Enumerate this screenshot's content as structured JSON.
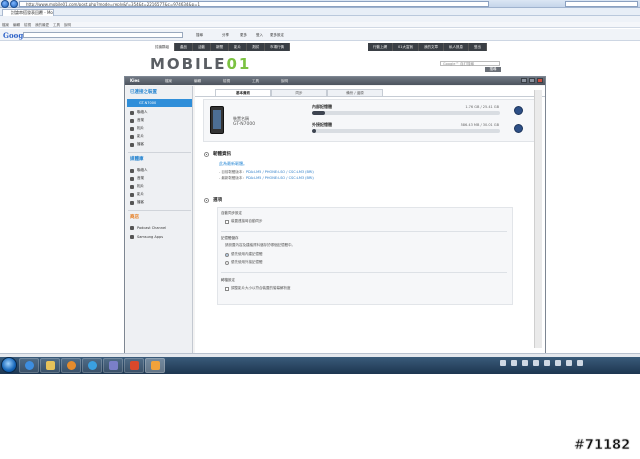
{
  "browser": {
    "url": "http://www.mobile01.com/post.php?mode=reply&f=354&t=2216577&c=974634&p=1",
    "tab_title": "討論串搭發表回覆 - Mobile...",
    "search_placeholder": "",
    "menu": [
      "檔案",
      "編輯",
      "檢視",
      "我的最愛",
      "工具",
      "說明"
    ],
    "google_label": "Google",
    "google_tools": [
      "搜尋",
      "分享",
      "更多",
      "登入",
      "更多設定"
    ]
  },
  "site": {
    "nav": [
      "討論群組",
      "產品",
      "活動",
      "新聞",
      "影片",
      "測試",
      "市場行情"
    ],
    "nav_right": [
      "行動上網",
      "01大富翁",
      "我的文章",
      "私人訊息",
      "登出"
    ],
    "logo_text": "MOBILE",
    "logo_accent": "01",
    "search_placeholder": "Google™ 自訂搜尋",
    "search_button": "搜尋"
  },
  "kies": {
    "title": "Kies",
    "menu": [
      "檔案",
      "編輯",
      "檢視",
      "工具",
      "說明"
    ],
    "sidebar": {
      "connected_head": "已連接之裝置",
      "device": "GT-N7000",
      "device_items": [
        "聯絡人",
        "音樂",
        "相片",
        "影片",
        "播客"
      ],
      "library_head": "媒體庫",
      "library_items": [
        "聯絡人",
        "音樂",
        "相片",
        "影片",
        "播客"
      ],
      "store_head": "商店",
      "store_items": [
        "Podcast Channel",
        "Samsung Apps"
      ]
    },
    "tabs": [
      "基本資訊",
      "同步",
      "備份 / 還原"
    ],
    "selected_tab": 0,
    "phone": {
      "model_caption": "裝置名稱",
      "model": "GT-N7000"
    },
    "storage": [
      {
        "label": "內部記憶體",
        "size": "1.76 GB / 25.41 GB",
        "fill": 0.07
      },
      {
        "label": "外接記憶體",
        "size": "586.43 MB / 30.01 GB",
        "fill": 0.02
      }
    ],
    "firmware": {
      "title": "韌體資訊",
      "status": "此為最新韌體。",
      "current_label": "- 目前韌體版本：",
      "current_value": "PDA:LM5 / PHONE:LSO / CSC:LM3 (BRI)",
      "latest_label": "- 最新韌體版本：",
      "latest_value": "PDA:LM5 / PHONE:LSO / CSC:LM3 (BRI)"
    },
    "options": {
      "title": "選項",
      "auto_sync_title": "自動同步設定",
      "auto_sync_item": "裝置連接時自動同步",
      "memory_title": "記憶體儲存",
      "memory_desc": "請設置內容及建議資料儲存於哪個記憶體中。",
      "memory_internal": "優先使用內建記憶體",
      "memory_external": "優先使用外接記憶體",
      "video_title": "轉檔設定",
      "video_item": "調整影片大小以符合裝置的螢幕解析度"
    }
  },
  "taskbar": {
    "clock_time": "",
    "clock_date": ""
  },
  "watermark": "#71182",
  "colors": {
    "accent": "#2e8bd6",
    "logo_green": "#7cc242",
    "sidebar_orange": "#e67a1c"
  }
}
